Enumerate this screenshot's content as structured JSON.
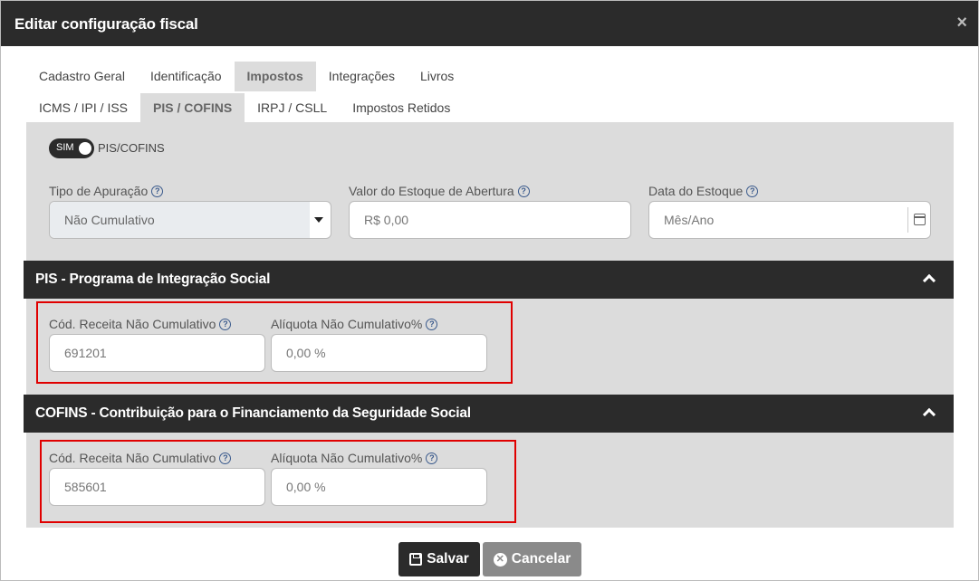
{
  "modal": {
    "title": "Editar configuração fiscal",
    "close": "×"
  },
  "tabs_row1": [
    "Cadastro Geral",
    "Identificação",
    "Impostos",
    "Integrações",
    "Livros"
  ],
  "tabs_row2": [
    "ICMS / IPI / ISS",
    "PIS / COFINS",
    "IRPJ / CSLL",
    "Impostos Retidos"
  ],
  "active_tabs": {
    "row1": "Impostos",
    "row2": "PIS / COFINS"
  },
  "toggle": {
    "state": "SIM",
    "label": "PIS/COFINS"
  },
  "general": {
    "tipo_apuracao": {
      "label": "Tipo de Apuração",
      "value": "Não Cumulativo"
    },
    "valor_estoque": {
      "label": "Valor do Estoque de Abertura",
      "placeholder": "R$ 0,00"
    },
    "data_estoque": {
      "label": "Data do Estoque",
      "placeholder": "Mês/Ano"
    }
  },
  "pis": {
    "title": "PIS - Programa de Integração Social",
    "cod_label": "Cód. Receita Não Cumulativo",
    "cod_value": "691201",
    "aliquota_label": "Alíquota Não Cumulativo%",
    "aliquota_value": "0,00 %"
  },
  "cofins": {
    "title": "COFINS - Contribuição para o Financiamento da Seguridade Social",
    "cod_label": "Cód. Receita Não Cumulativo",
    "cod_value": "585601",
    "aliquota_label": "Alíquota Não Cumulativo%",
    "aliquota_value": "0,00 %"
  },
  "buttons": {
    "save": "Salvar",
    "cancel": "Cancelar"
  },
  "help": "?",
  "colors": {
    "header_dark": "#2b2b2b",
    "panel_gray": "#dcdcdc",
    "highlight_red": "#e00000",
    "cancel_gray": "#8a8a8a",
    "help_blue": "#3a5a8c"
  }
}
